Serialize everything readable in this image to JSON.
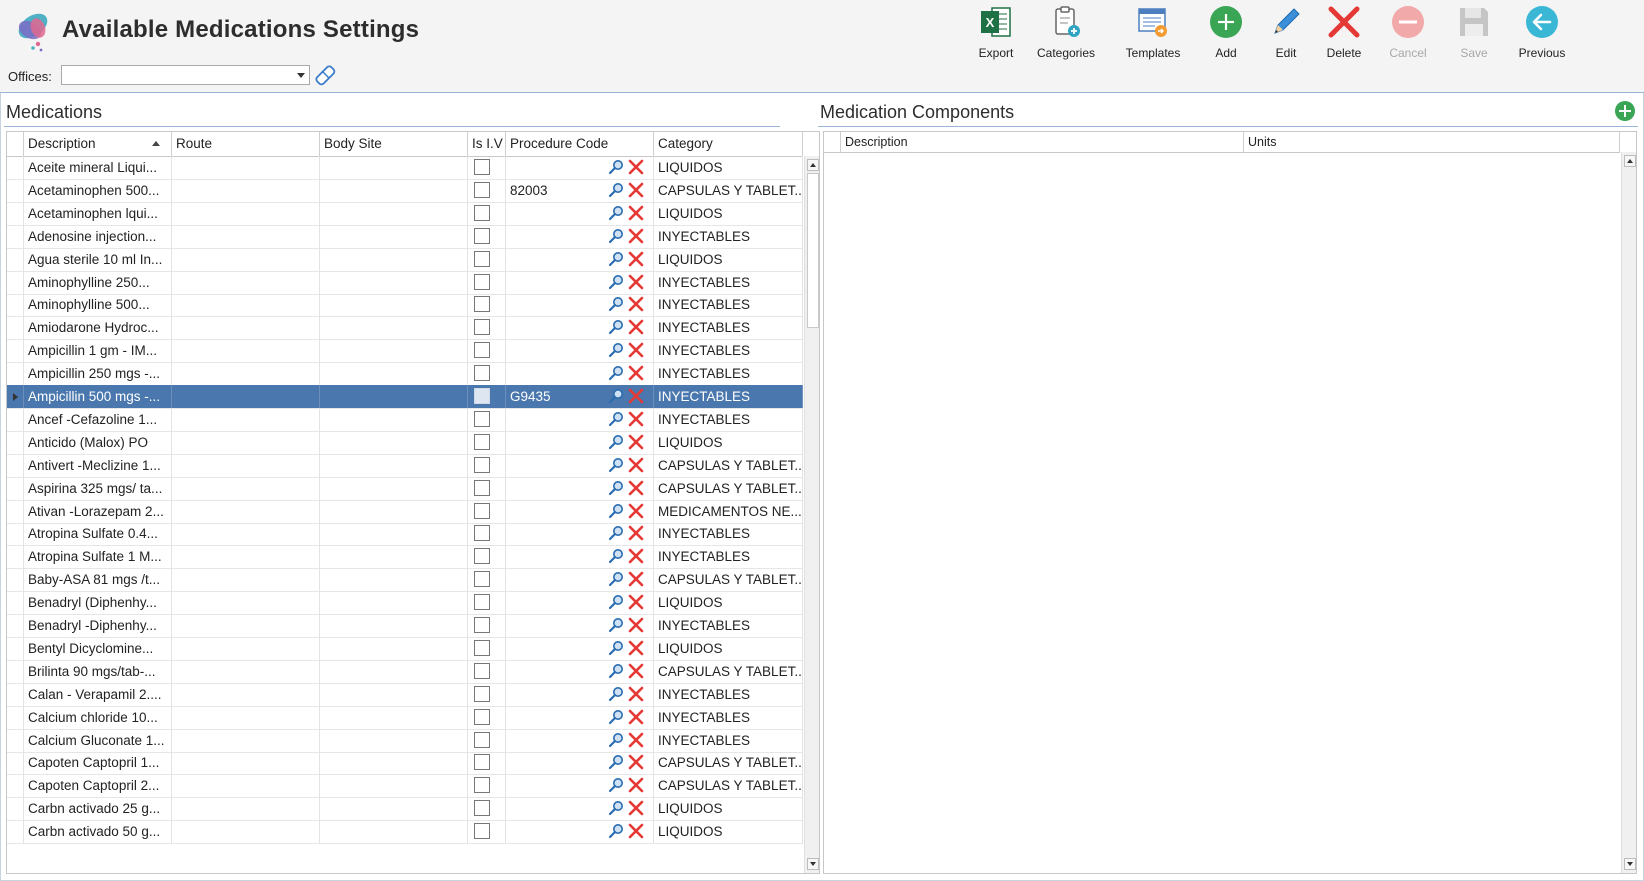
{
  "header": {
    "title": "Available Medications Settings",
    "logo_icon": "medications-logo-icon"
  },
  "toolbar": [
    {
      "name": "export-button",
      "label": "Export",
      "icon": "excel-icon",
      "enabled": true
    },
    {
      "name": "categories-button",
      "label": "Categories",
      "icon": "clipboard-add-icon",
      "enabled": true
    },
    {
      "name": "templates-button",
      "label": "Templates",
      "icon": "template-icon",
      "enabled": true
    },
    {
      "name": "add-button",
      "label": "Add",
      "icon": "plus-circle-icon",
      "enabled": true
    },
    {
      "name": "edit-button",
      "label": "Edit",
      "icon": "pencil-icon",
      "enabled": true
    },
    {
      "name": "delete-button",
      "label": "Delete",
      "icon": "x-icon",
      "enabled": true
    },
    {
      "name": "cancel-button",
      "label": "Cancel",
      "icon": "minus-circle-icon",
      "enabled": false
    },
    {
      "name": "save-button",
      "label": "Save",
      "icon": "floppy-icon",
      "enabled": false
    },
    {
      "name": "previous-button",
      "label": "Previous",
      "icon": "arrow-left-circle-icon",
      "enabled": true
    }
  ],
  "offices": {
    "label": "Offices:",
    "value": ""
  },
  "medications": {
    "title": "Medications",
    "columns": [
      "Description",
      "Route",
      "Body Site",
      "Is I.V",
      "Procedure Code",
      "Category"
    ],
    "rows": [
      {
        "description": "Aceite mineral Liqui...",
        "route": "",
        "body_site": "",
        "is_iv": false,
        "procedure_code": "",
        "category": "LIQUIDOS"
      },
      {
        "description": "Acetaminophen 500...",
        "route": "",
        "body_site": "",
        "is_iv": false,
        "procedure_code": "82003",
        "category": "CAPSULAS Y TABLET..."
      },
      {
        "description": "Acetaminophen lqui...",
        "route": "",
        "body_site": "",
        "is_iv": false,
        "procedure_code": "",
        "category": "LIQUIDOS"
      },
      {
        "description": "Adenosine injection...",
        "route": "",
        "body_site": "",
        "is_iv": false,
        "procedure_code": "",
        "category": "INYECTABLES"
      },
      {
        "description": "Agua sterile 10 ml In...",
        "route": "",
        "body_site": "",
        "is_iv": false,
        "procedure_code": "",
        "category": "LIQUIDOS"
      },
      {
        "description": "Aminophylline 250...",
        "route": "",
        "body_site": "",
        "is_iv": false,
        "procedure_code": "",
        "category": "INYECTABLES"
      },
      {
        "description": "Aminophylline 500...",
        "route": "",
        "body_site": "",
        "is_iv": false,
        "procedure_code": "",
        "category": "INYECTABLES"
      },
      {
        "description": "Amiodarone Hydroc...",
        "route": "",
        "body_site": "",
        "is_iv": false,
        "procedure_code": "",
        "category": "INYECTABLES"
      },
      {
        "description": "Ampicillin 1 gm - IM...",
        "route": "",
        "body_site": "",
        "is_iv": false,
        "procedure_code": "",
        "category": "INYECTABLES"
      },
      {
        "description": "Ampicillin 250 mgs -...",
        "route": "",
        "body_site": "",
        "is_iv": false,
        "procedure_code": "",
        "category": "INYECTABLES"
      },
      {
        "description": "Ampicillin 500 mgs -...",
        "route": "",
        "body_site": "",
        "is_iv": false,
        "procedure_code": "G9435",
        "category": "INYECTABLES",
        "selected": true
      },
      {
        "description": "Ancef -Cefazoline  1...",
        "route": "",
        "body_site": "",
        "is_iv": false,
        "procedure_code": "",
        "category": "INYECTABLES"
      },
      {
        "description": "Anticido (Malox) PO",
        "route": "",
        "body_site": "",
        "is_iv": false,
        "procedure_code": "",
        "category": "LIQUIDOS"
      },
      {
        "description": "Antivert -Meclizine 1...",
        "route": "",
        "body_site": "",
        "is_iv": false,
        "procedure_code": "",
        "category": "CAPSULAS Y TABLET..."
      },
      {
        "description": "Aspirina 325 mgs/ ta...",
        "route": "",
        "body_site": "",
        "is_iv": false,
        "procedure_code": "",
        "category": "CAPSULAS Y TABLET..."
      },
      {
        "description": "Ativan -Lorazepam 2...",
        "route": "",
        "body_site": "",
        "is_iv": false,
        "procedure_code": "",
        "category": "MEDICAMENTOS NE..."
      },
      {
        "description": "Atropina Sulfate 0.4...",
        "route": "",
        "body_site": "",
        "is_iv": false,
        "procedure_code": "",
        "category": "INYECTABLES"
      },
      {
        "description": "Atropina Sulfate 1 M...",
        "route": "",
        "body_site": "",
        "is_iv": false,
        "procedure_code": "",
        "category": "INYECTABLES"
      },
      {
        "description": "Baby-ASA 81 mgs /t...",
        "route": "",
        "body_site": "",
        "is_iv": false,
        "procedure_code": "",
        "category": "CAPSULAS Y TABLET..."
      },
      {
        "description": "Benadryl (Diphenhy...",
        "route": "",
        "body_site": "",
        "is_iv": false,
        "procedure_code": "",
        "category": "LIQUIDOS"
      },
      {
        "description": "Benadryl -Diphenhy...",
        "route": "",
        "body_site": "",
        "is_iv": false,
        "procedure_code": "",
        "category": "INYECTABLES"
      },
      {
        "description": "Bentyl Dicyclomine...",
        "route": "",
        "body_site": "",
        "is_iv": false,
        "procedure_code": "",
        "category": "LIQUIDOS"
      },
      {
        "description": "Brilinta 90 mgs/tab-...",
        "route": "",
        "body_site": "",
        "is_iv": false,
        "procedure_code": "",
        "category": "CAPSULAS Y TABLET..."
      },
      {
        "description": "Calan - Verapamil 2....",
        "route": "",
        "body_site": "",
        "is_iv": false,
        "procedure_code": "",
        "category": "INYECTABLES"
      },
      {
        "description": "Calcium chloride 10...",
        "route": "",
        "body_site": "",
        "is_iv": false,
        "procedure_code": "",
        "category": "INYECTABLES"
      },
      {
        "description": "Calcium Gluconate 1...",
        "route": "",
        "body_site": "",
        "is_iv": false,
        "procedure_code": "",
        "category": "INYECTABLES"
      },
      {
        "description": "Capoten Captopril 1...",
        "route": "",
        "body_site": "",
        "is_iv": false,
        "procedure_code": "",
        "category": "CAPSULAS Y TABLET..."
      },
      {
        "description": "Capoten Captopril 2...",
        "route": "",
        "body_site": "",
        "is_iv": false,
        "procedure_code": "",
        "category": "CAPSULAS Y TABLET..."
      },
      {
        "description": "Carbn activado 25 g...",
        "route": "",
        "body_site": "",
        "is_iv": false,
        "procedure_code": "",
        "category": "LIQUIDOS"
      },
      {
        "description": "Carbn activado 50 g...",
        "route": "",
        "body_site": "",
        "is_iv": false,
        "procedure_code": "",
        "category": "LIQUIDOS"
      }
    ]
  },
  "components": {
    "title": "Medication Components",
    "columns": [
      "Description",
      "Units"
    ],
    "add_icon": "plus-circle-icon"
  },
  "colors": {
    "selected_row": "#4a77ad",
    "accent_line": "#9ab5d6",
    "delete_red": "#e53935",
    "add_green": "#3aa655"
  }
}
